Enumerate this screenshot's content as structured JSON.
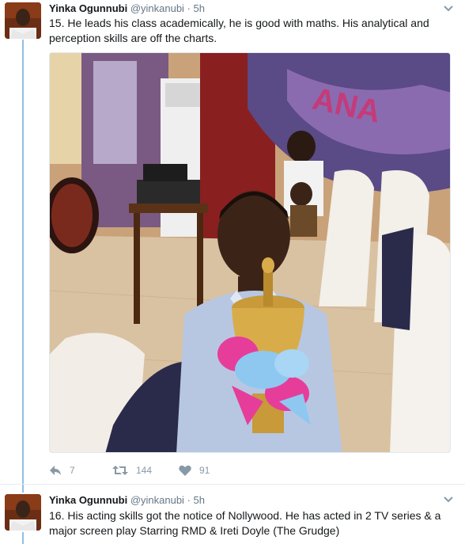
{
  "tweets": [
    {
      "author_name": "Yinka Ogunnubi",
      "handle": "@yinkanubi",
      "separator": "·",
      "time": "5h",
      "text": "15. He leads his class academically, he is good with maths. His analytical and perception skills are off the charts.",
      "media_icon": "photo-boy-with-trophy",
      "actions": {
        "reply_count": "7",
        "retweet_count": "144",
        "like_count": "91"
      }
    },
    {
      "author_name": "Yinka Ogunnubi",
      "handle": "@yinkanubi",
      "separator": "·",
      "time": "5h",
      "text": "16. His acting skills got the notice of Nollywood. He has acted in 2 TV series & a major screen play Starring RMD & Ireti Doyle (The Grudge)"
    }
  ],
  "colors": {
    "thread_line": "#8ec0e4",
    "secondary_text": "#657786",
    "action_icon": "#8899a6"
  },
  "icons": [
    "chevron-down-icon",
    "reply-icon",
    "retweet-icon",
    "heart-icon"
  ]
}
